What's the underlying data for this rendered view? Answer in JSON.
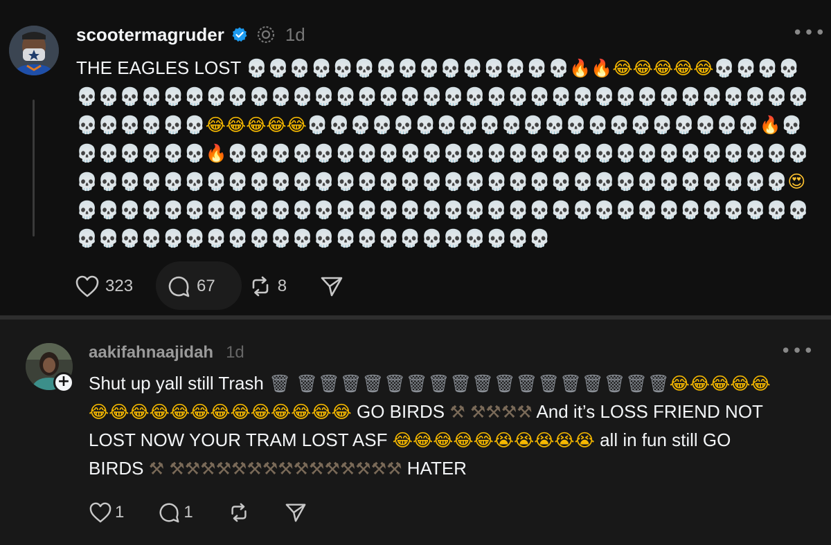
{
  "post1": {
    "username": "scootermagruder",
    "time": "1d",
    "text_prefix": "THE EAGLES LOST ",
    "emoji_sequence": [
      [
        "skull",
        15
      ],
      [
        "fire",
        2
      ],
      [
        "laugh",
        5
      ],
      [
        "skull",
        5
      ],
      [
        "skull",
        36
      ],
      [
        "skull",
        3
      ],
      [
        "laugh",
        5
      ],
      [
        "skull",
        21
      ],
      [
        "fire",
        1
      ],
      [
        "skull",
        6
      ],
      [
        "skull",
        1
      ],
      [
        "fire",
        1
      ],
      [
        "skull",
        34
      ],
      [
        "skull",
        26
      ],
      [
        "heart-eyes",
        1
      ],
      [
        "skull",
        9
      ],
      [
        "skull",
        36
      ],
      [
        "skull",
        11
      ]
    ],
    "likes": "323",
    "replies": "67",
    "reposts": "8"
  },
  "post2": {
    "username": "aakifahnaajidah",
    "time": "1d",
    "segments": [
      {
        "t": "text",
        "v": "Shut up yall still Trash "
      },
      {
        "t": "emoji",
        "k": "trash",
        "n": 1
      },
      {
        "t": "text",
        "v": " "
      },
      {
        "t": "emoji",
        "k": "trash",
        "n": 17
      },
      {
        "t": "emoji",
        "k": "laugh",
        "n": 6
      },
      {
        "t": "emoji",
        "k": "laugh",
        "n": 12
      },
      {
        "t": "text",
        "v": " GO BIRDS "
      },
      {
        "t": "emoji",
        "k": "hammer",
        "n": 1
      },
      {
        "t": "text",
        "v": " "
      },
      {
        "t": "emoji",
        "k": "hammer",
        "n": 4
      },
      {
        "t": "text",
        "v": " And it’s LOSS FRIEND NOT LOST NOW YOUR TRAM LOST ASF "
      },
      {
        "t": "emoji",
        "k": "laugh",
        "n": 5
      },
      {
        "t": "emoji",
        "k": "cry",
        "n": 5
      },
      {
        "t": "text",
        "v": " all in fun still GO BIRDS "
      },
      {
        "t": "emoji",
        "k": "hammer",
        "n": 1
      },
      {
        "t": "text",
        "v": " "
      },
      {
        "t": "emoji",
        "k": "hammer",
        "n": 15
      },
      {
        "t": "text",
        "v": " HATER"
      }
    ],
    "likes": "1",
    "replies": "1"
  },
  "emoji_glyphs": {
    "skull": "💀",
    "fire": "🔥",
    "laugh": "😂",
    "heart-eyes": "😍",
    "trash": "🗑",
    "cry": "😭",
    "hammer": "⚒"
  },
  "more_label": "•••",
  "colors": {
    "verified": "#1d9bf0",
    "background": "#101010",
    "reply_background": "#181818"
  }
}
